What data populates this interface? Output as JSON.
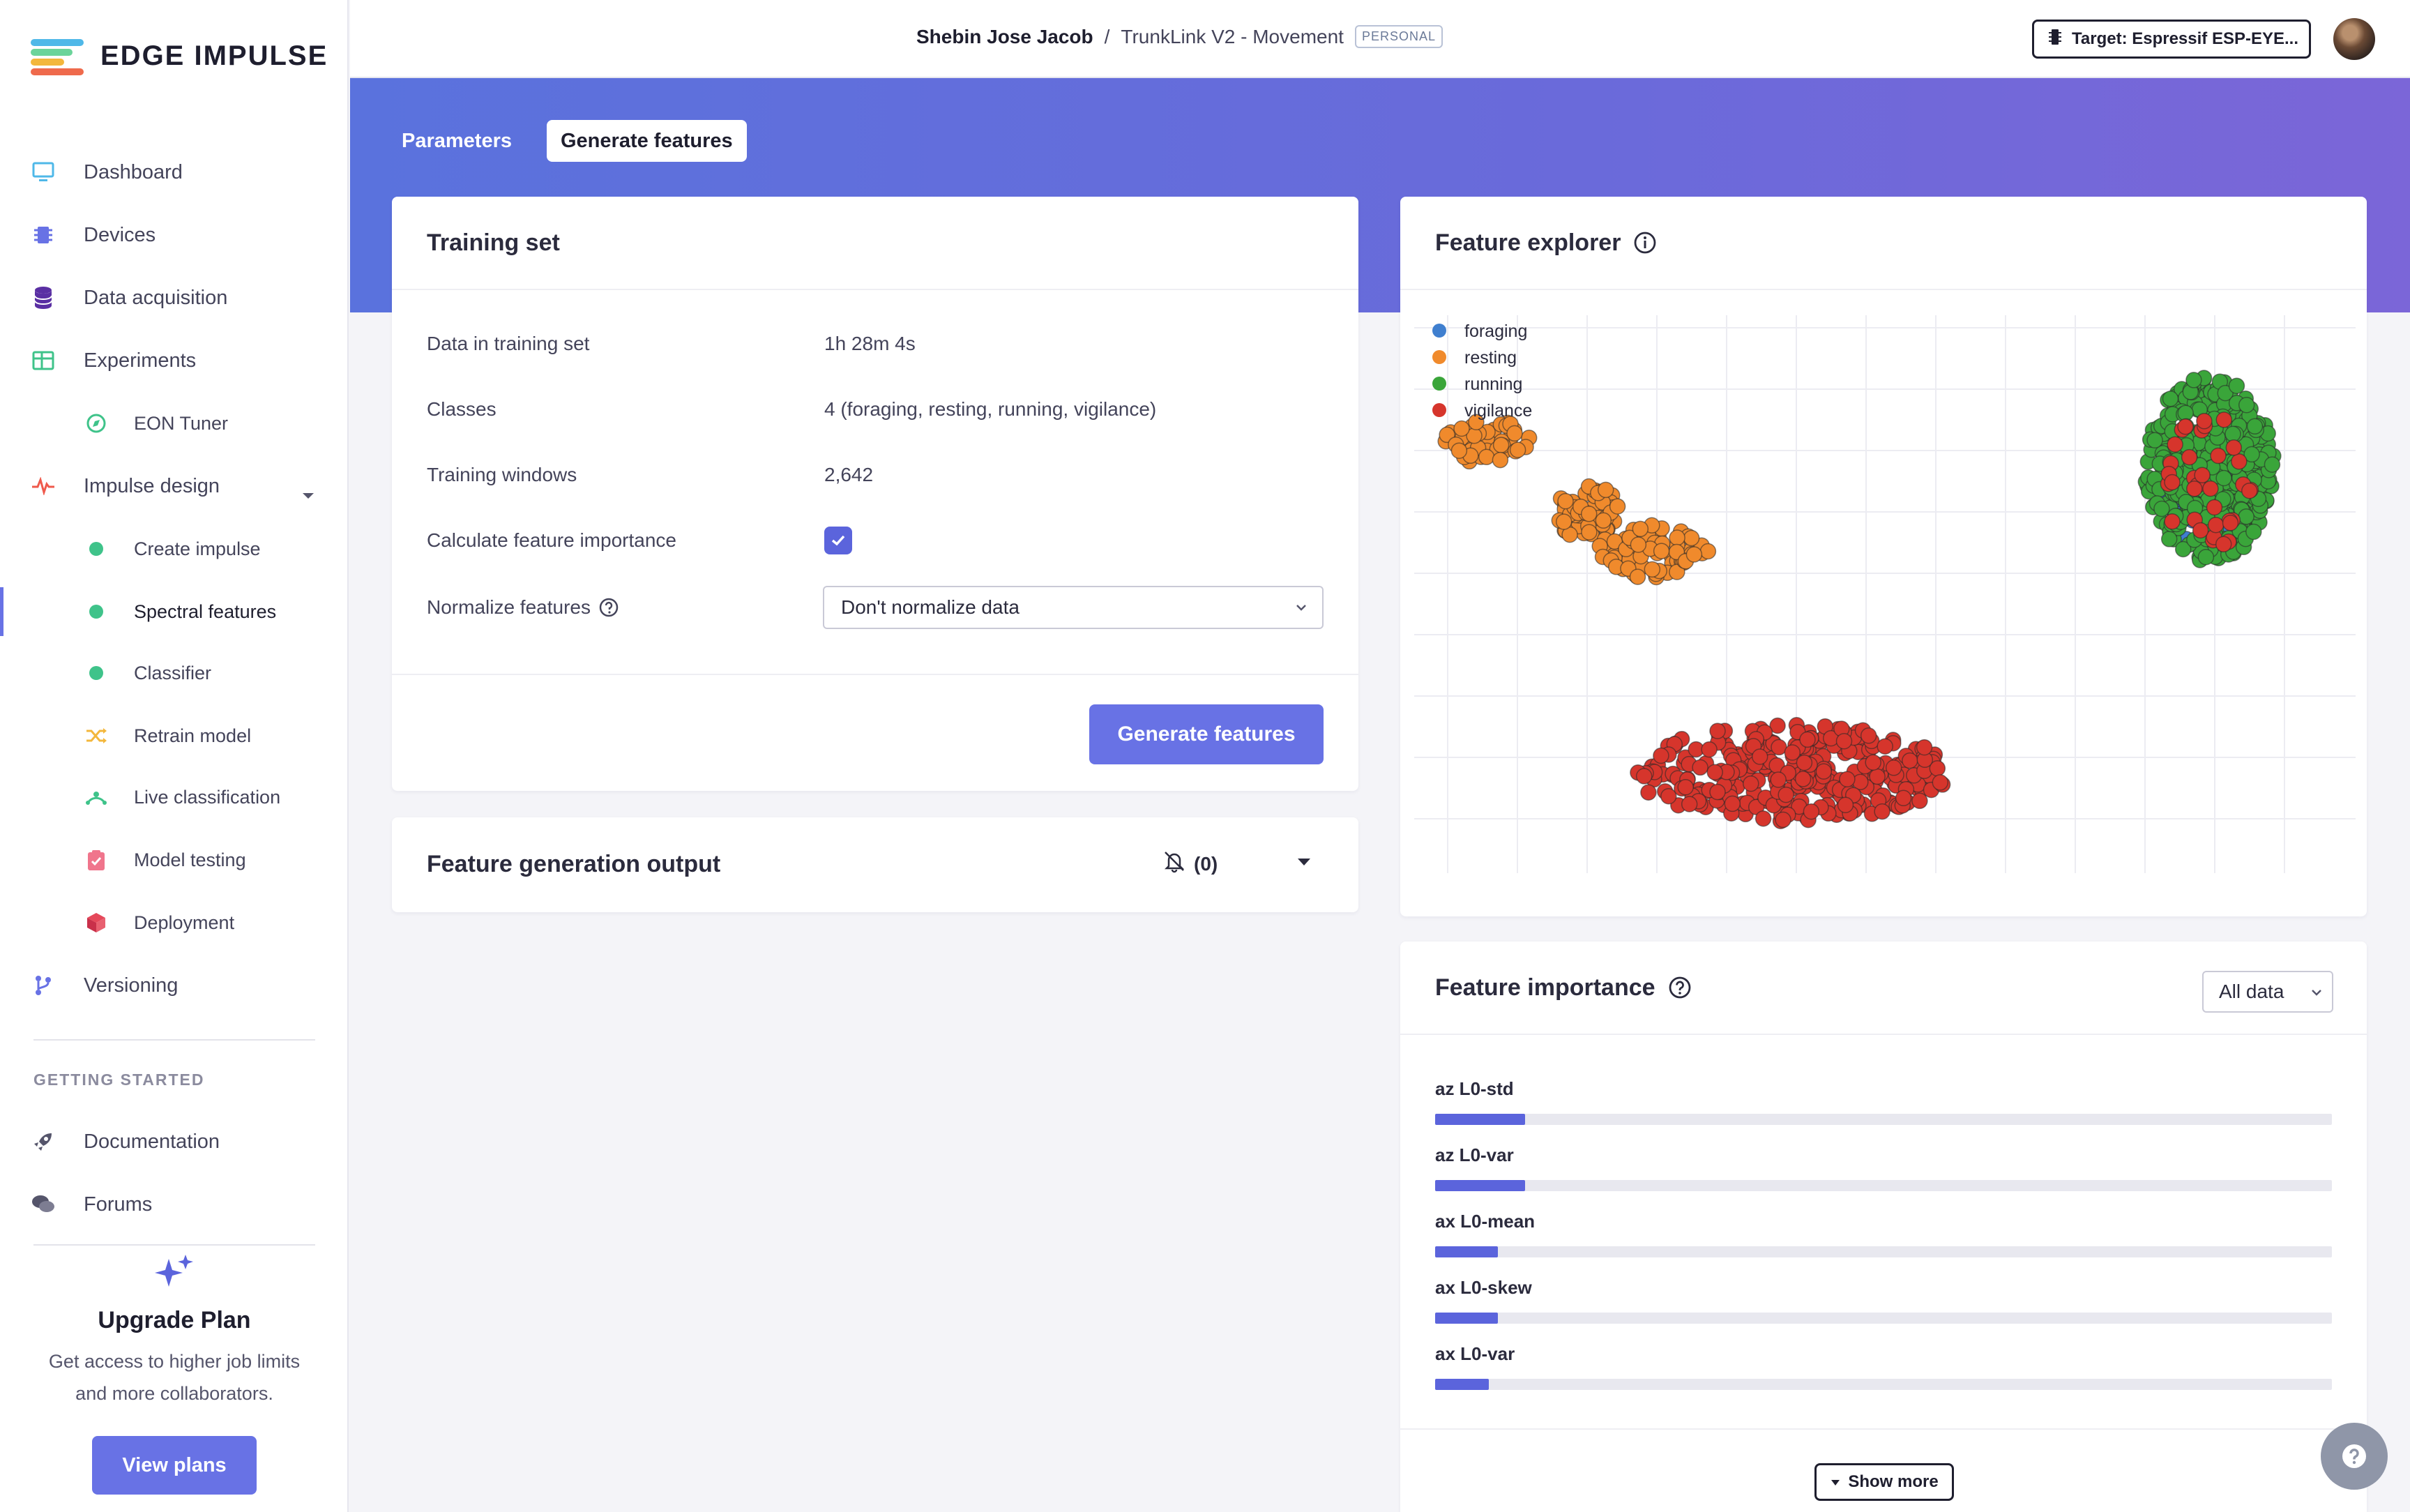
{
  "app": {
    "logo_text": "EDGE IMPULSE"
  },
  "sidebar": {
    "main": [
      {
        "label": "Dashboard",
        "icon": "monitor-icon"
      },
      {
        "label": "Devices",
        "icon": "chip-icon"
      },
      {
        "label": "Data acquisition",
        "icon": "database-icon"
      },
      {
        "label": "Experiments",
        "icon": "table-icon"
      }
    ],
    "eon_tuner": "EON Tuner",
    "impulse_design": "Impulse design",
    "impulse_items": [
      {
        "label": "Create impulse"
      },
      {
        "label": "Spectral features",
        "active": true
      },
      {
        "label": "Classifier"
      },
      {
        "label": "Retrain model"
      },
      {
        "label": "Live classification"
      },
      {
        "label": "Model testing"
      },
      {
        "label": "Deployment"
      }
    ],
    "versioning": "Versioning",
    "getting_started_label": "GETTING STARTED",
    "documentation": "Documentation",
    "forums": "Forums",
    "upgrade": {
      "title": "Upgrade Plan",
      "line1": "Get access to higher job limits",
      "line2": "and more collaborators.",
      "button": "View plans"
    }
  },
  "header": {
    "user": "Shebin Jose Jacob",
    "separator": "/",
    "project": "TrunkLink V2 - Movement",
    "badge": "PERSONAL",
    "target": "Target: Espressif ESP-EYE..."
  },
  "tabs": {
    "parameters": "Parameters",
    "generate": "Generate features"
  },
  "training_set": {
    "title": "Training set",
    "rows": [
      {
        "label": "Data in training set",
        "value": "1h 28m 4s"
      },
      {
        "label": "Classes",
        "value": "4 (foraging, resting, running, vigilance)"
      },
      {
        "label": "Training windows",
        "value": "2,642"
      },
      {
        "label": "Calculate feature importance"
      },
      {
        "label": "Normalize features"
      }
    ],
    "normalize_value": "Don't normalize data",
    "generate_button": "Generate features"
  },
  "output": {
    "title": "Feature generation output",
    "count": "(0)"
  },
  "explorer": {
    "title": "Feature explorer",
    "legend": [
      {
        "name": "foraging",
        "color": "#3f7fcf"
      },
      {
        "name": "resting",
        "color": "#f08a2c"
      },
      {
        "name": "running",
        "color": "#3aa53a"
      },
      {
        "name": "vigilance",
        "color": "#d6352c"
      }
    ]
  },
  "chart_data": {
    "type": "scatter",
    "title": "",
    "xlabel": "",
    "ylabel": "",
    "grid": true,
    "legend_position": "top-left",
    "series": [
      {
        "name": "foraging",
        "clusters": [
          {
            "cx": 0.85,
            "cy": 0.3,
            "rx": 0.05,
            "ry": 0.12,
            "n": 110
          }
        ]
      },
      {
        "name": "resting",
        "clusters": [
          {
            "cx": 0.18,
            "cy": 0.35,
            "rx": 0.035,
            "ry": 0.05,
            "n": 60
          },
          {
            "cx": 0.25,
            "cy": 0.42,
            "rx": 0.06,
            "ry": 0.05,
            "n": 70
          },
          {
            "cx": 0.07,
            "cy": 0.22,
            "rx": 0.05,
            "ry": 0.04,
            "n": 45
          }
        ]
      },
      {
        "name": "running",
        "clusters": [
          {
            "cx": 0.85,
            "cy": 0.27,
            "rx": 0.07,
            "ry": 0.17,
            "n": 380
          }
        ]
      },
      {
        "name": "vigilance",
        "clusters": [
          {
            "cx": 0.4,
            "cy": 0.83,
            "rx": 0.17,
            "ry": 0.09,
            "n": 300
          },
          {
            "cx": 0.85,
            "cy": 0.3,
            "rx": 0.05,
            "ry": 0.13,
            "n": 35
          }
        ]
      }
    ]
  },
  "importance": {
    "title": "Feature importance",
    "filter": "All data",
    "features": [
      {
        "name": "az L0-std",
        "value": 0.1
      },
      {
        "name": "az L0-var",
        "value": 0.1
      },
      {
        "name": "ax L0-mean",
        "value": 0.07
      },
      {
        "name": "ax L0-skew",
        "value": 0.07
      },
      {
        "name": "ax L0-var",
        "value": 0.06
      }
    ],
    "show_more": "Show more"
  },
  "colors": {
    "accent": "#6872e5",
    "band_start": "#5a72dd",
    "band_end": "#7b66d8"
  }
}
